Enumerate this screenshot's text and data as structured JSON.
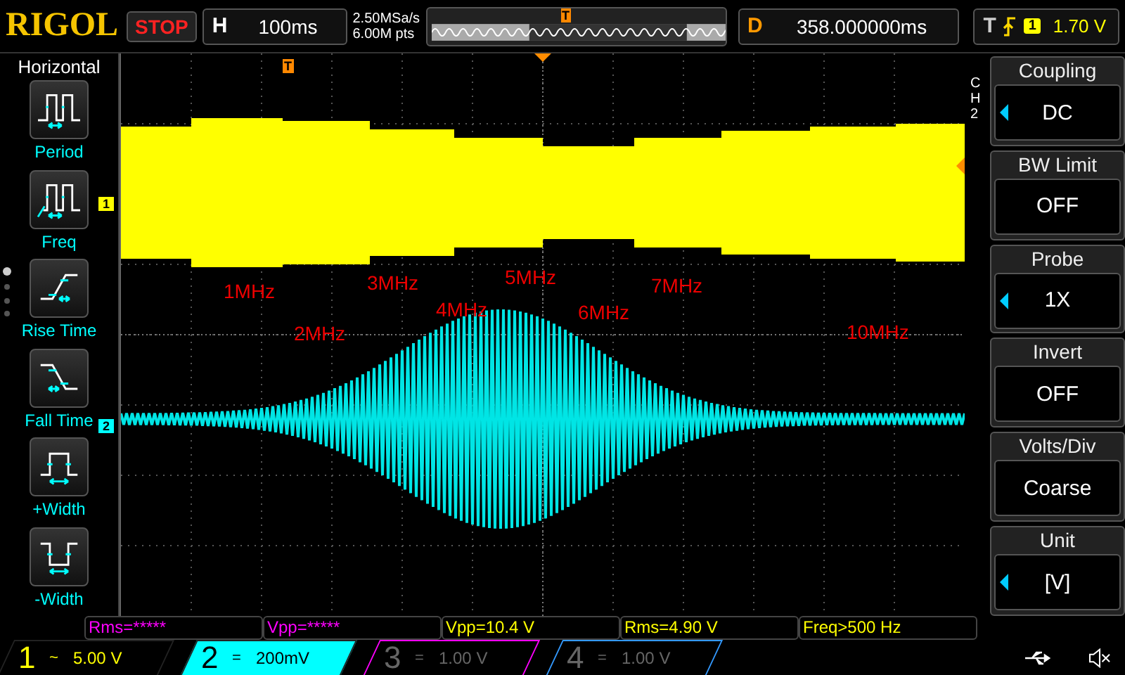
{
  "top_bar": {
    "logo": "RIGOL",
    "run_state": "STOP",
    "horizontal": {
      "label": "H",
      "timebase": "100ms"
    },
    "sample_rate": "2.50MSa/s",
    "memory_depth": "6.00M pts",
    "trigger_marker": "T",
    "delay": {
      "label": "D",
      "value": "358.000000ms"
    },
    "trigger": {
      "label": "T",
      "source": "1",
      "level": "1.70 V"
    }
  },
  "left_menu": {
    "title": "Horizontal",
    "items": [
      {
        "kind": "period",
        "label": "Period"
      },
      {
        "kind": "freq",
        "label": "Freq"
      },
      {
        "kind": "rise",
        "label": "Rise Time"
      },
      {
        "kind": "fall",
        "label": "Fall Time"
      },
      {
        "kind": "pwidth",
        "label": "+Width"
      },
      {
        "kind": "nwidth",
        "label": "-Width"
      }
    ]
  },
  "plot": {
    "trigger_marker": "T",
    "channel_markers": [
      {
        "label": "1",
        "color": "#ffff00"
      },
      {
        "label": "2",
        "color": "#00ffff"
      }
    ],
    "annotations": [
      "1MHz",
      "2MHz",
      "3MHz",
      "4MHz",
      "5MHz",
      "6MHz",
      "7MHz",
      "10MHz"
    ]
  },
  "right_menu": {
    "channel": "CH2",
    "items": [
      {
        "title": "Coupling",
        "value": "DC",
        "adjustable": true
      },
      {
        "title": "BW Limit",
        "value": "OFF",
        "adjustable": false
      },
      {
        "title": "Probe",
        "value": "1X",
        "adjustable": true
      },
      {
        "title": "Invert",
        "value": "OFF",
        "adjustable": false
      },
      {
        "title": "Volts/Div",
        "value": "Coarse",
        "adjustable": false
      },
      {
        "title": "Unit",
        "value": "[V]",
        "adjustable": true
      }
    ]
  },
  "measurements": [
    {
      "text": "Rms=*****",
      "color": "#ff00ff"
    },
    {
      "text": "Vpp=*****",
      "color": "#ff00ff"
    },
    {
      "text": "Vpp=10.4 V",
      "color": "#ffff00"
    },
    {
      "text": "Rms=4.90 V",
      "color": "#ffff00"
    },
    {
      "text": "Freq>500 Hz",
      "color": "#ffff00"
    }
  ],
  "channels": [
    {
      "number": "1",
      "coupling": "~",
      "scale": "5.00 V",
      "color": "#ffff00",
      "enabled": true,
      "selected": false
    },
    {
      "number": "2",
      "coupling": "=",
      "scale": "200mV",
      "color": "#00ffff",
      "enabled": true,
      "selected": true
    },
    {
      "number": "3",
      "coupling": "=",
      "scale": "1.00 V",
      "color": "#ff00ff",
      "enabled": false,
      "selected": false
    },
    {
      "number": "4",
      "coupling": "=",
      "scale": "1.00 V",
      "color": "#3399ff",
      "enabled": false,
      "selected": false
    }
  ]
}
